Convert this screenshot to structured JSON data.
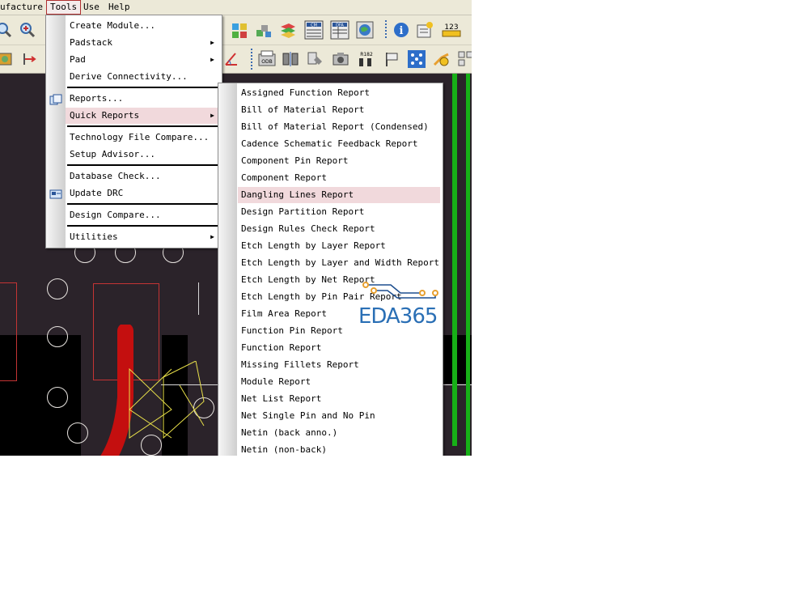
{
  "menubar": {
    "items": [
      {
        "label": "ufacture"
      },
      {
        "label": "Tools"
      },
      {
        "label": "Use"
      },
      {
        "label": "Help"
      }
    ]
  },
  "toolbar_badges": {
    "cm": "CM",
    "dfa": "DFA",
    "num": "123",
    "odb": "ODB",
    "r182": "R182"
  },
  "tools_menu": {
    "items": [
      {
        "label": "Create Module...",
        "has_submenu": false
      },
      {
        "label": "Padstack",
        "has_submenu": true
      },
      {
        "label": "Pad",
        "has_submenu": true
      },
      {
        "label": "Derive Connectivity...",
        "has_submenu": false
      },
      {
        "label": "Reports...",
        "has_submenu": false
      },
      {
        "label": "Quick Reports",
        "has_submenu": true,
        "highlighted": true
      },
      {
        "label": "Technology File Compare...",
        "has_submenu": false
      },
      {
        "label": "Setup Advisor...",
        "has_submenu": false
      },
      {
        "label": "Database Check...",
        "has_submenu": false
      },
      {
        "label": "Update DRC",
        "has_submenu": false
      },
      {
        "label": "Design Compare...",
        "has_submenu": false
      },
      {
        "label": "Utilities",
        "has_submenu": true
      }
    ],
    "arrow_glyph": "▶"
  },
  "quick_reports": {
    "items": [
      "Assigned Function Report",
      "Bill of Material Report",
      "Bill of Material Report (Condensed)",
      "Cadence Schematic Feedback Report",
      "Component Pin Report",
      "Component Report",
      "Dangling Lines Report",
      "Design Partition Report",
      "Design Rules Check Report",
      "Etch Length by Layer Report",
      "Etch Length by Layer and Width Report",
      "Etch Length by Net Report",
      "Etch Length by Pin Pair Report",
      "Film Area Report",
      "Function Pin Report",
      "Function Report",
      "Missing Fillets Report",
      "Module Report",
      "Net List Report",
      "Net Single Pin and No Pin",
      "Netin (back anno.)",
      "Netin (non-back)"
    ],
    "highlighted_index": 6
  },
  "watermark": {
    "text": "EDA365"
  },
  "colors": {
    "highlight": "#f1d9dc",
    "canvas": "#2b232a",
    "logo": "#2a6fb5",
    "logo_accent": "#e8a030"
  }
}
